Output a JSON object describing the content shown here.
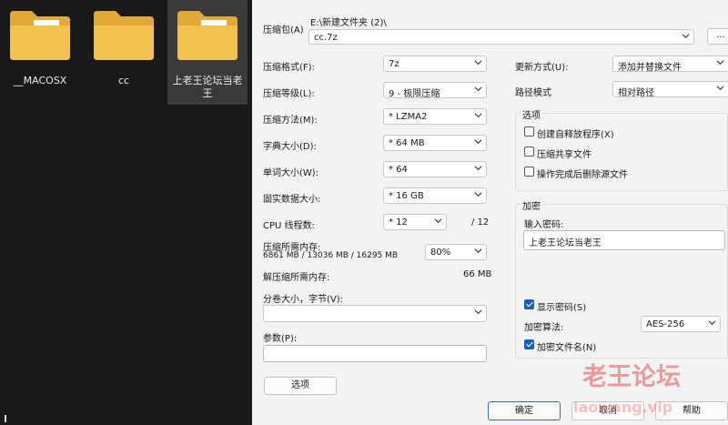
{
  "explorer": {
    "items": [
      {
        "label": "__MACOSX"
      },
      {
        "label": "cc"
      },
      {
        "label": "上老王论坛当老王"
      }
    ]
  },
  "dialog": {
    "archive_label": "压缩包(A)",
    "path": "E:\\新建文件夹 (2)\\",
    "archive_name": "cc.7z",
    "browse_label": "...",
    "format_label": "压缩格式(F):",
    "format_value": "7z",
    "level_label": "压缩等级(L):",
    "level_value": "9 - 极限压缩",
    "method_label": "压缩方法(M):",
    "method_value": "*  LZMA2",
    "dict_label": "字典大小(D):",
    "dict_value": "*  64 MB",
    "word_label": "单词大小(W):",
    "word_value": "*  64",
    "solid_label": "固实数据大小:",
    "solid_value": "*  16 GB",
    "cpu_label": "CPU 线程数:",
    "cpu_value": "*  12",
    "cpu_total": "/ 12",
    "mem_comp_label": "压缩所需内存:",
    "mem_comp_detail": "6861 MB / 13036 MB / 16295 MB",
    "mem_percent": "80%",
    "mem_decomp_label": "解压缩所需内存:",
    "mem_decomp_value": "66 MB",
    "split_label": "分卷大小，字节(V):",
    "split_value": "",
    "params_label": "参数(P):",
    "params_value": "",
    "options_button": "选项",
    "update_label": "更新方式(U):",
    "update_value": "添加并替换文件",
    "pathmode_label": "路径模式",
    "pathmode_value": "相对路径",
    "options_group": {
      "title": "选项",
      "sfx": "创建自释放程序(X)",
      "shared": "压缩共享文件",
      "delete": "操作完成后删除源文件"
    },
    "encrypt_group": {
      "title": "加密",
      "password_label": "输入密码:",
      "password_value": "上老王论坛当老王",
      "show_password": "显示密码(S)",
      "method_label": "加密算法:",
      "method_value": "AES-256",
      "encrypt_names": "加密文件名(N)"
    },
    "ok": "确定",
    "cancel": "取消",
    "help": "帮助"
  },
  "watermark": {
    "cn": "老王论坛",
    "en": "laowang.vip"
  },
  "colors": {
    "folder": "#f2c14e",
    "folder_back": "#e0a93a",
    "accent": "#1a5fb4",
    "watermark": "#e05050"
  }
}
